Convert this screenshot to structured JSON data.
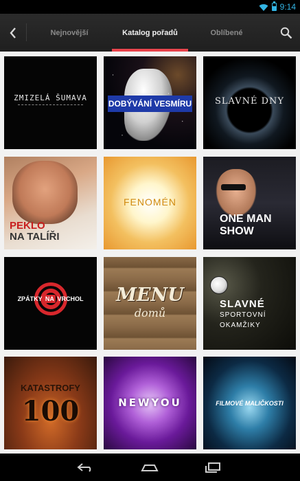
{
  "status_bar": {
    "time": "9:14",
    "accent_color": "#33b5e5",
    "icons": [
      "wifi-icon",
      "battery-icon"
    ]
  },
  "action_bar": {
    "back_icon": "chevron-left-icon",
    "search_icon": "search-icon",
    "tabs": [
      {
        "label": "Nejnovější",
        "active": false
      },
      {
        "label": "Katalog pořadů",
        "active": true
      },
      {
        "label": "Oblíbené",
        "active": false
      }
    ],
    "indicator_color": "#e8424a"
  },
  "catalog": [
    {
      "title": "ZMIZELÁ ŠUMAVA"
    },
    {
      "title": "DOBÝVÁNÍ VESMÍRU"
    },
    {
      "title": "SLAVNÉ DNY"
    },
    {
      "title_line1": "PEKLO",
      "title_line2": "NA TALÍŘI"
    },
    {
      "title": "FENOMÉN"
    },
    {
      "title_line1": "ONE MAN",
      "title_line2": "SHOW"
    },
    {
      "title_left": "ZPÁTKY",
      "title_mid": "NA",
      "title_right": "VRCHOL"
    },
    {
      "title_line1": "MENU",
      "title_line2": "domů"
    },
    {
      "title_line1": "SLAVNÉ",
      "title_line2": "SPORTOVNÍ",
      "title_line3": "OKAMŽIKY"
    },
    {
      "title_line1": "KATASTROFY",
      "title_line2": "100"
    },
    {
      "title": "NEWYOU"
    },
    {
      "title": "FILMOVÉ MALIČKOSTI"
    }
  ],
  "nav_bar": {
    "icons": [
      "back-icon",
      "home-icon",
      "recent-apps-icon"
    ]
  }
}
